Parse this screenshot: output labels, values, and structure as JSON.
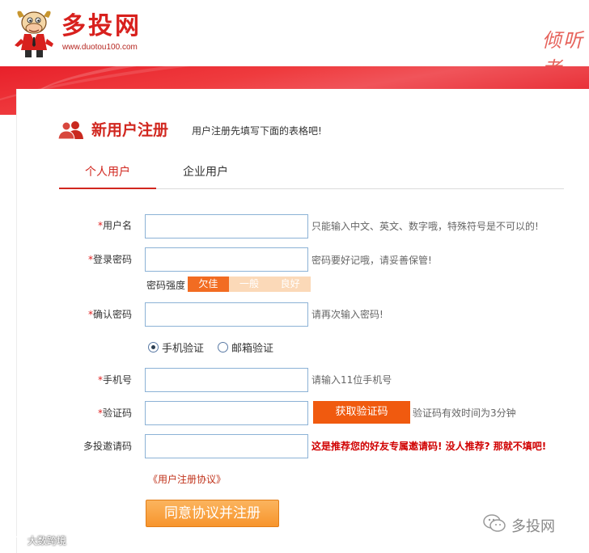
{
  "header": {
    "logo_text": "多投网",
    "logo_url": "www.duotou100.com",
    "slogan": "倾听者"
  },
  "registration": {
    "title": "新用户注册",
    "subtitle": "用户注册先填写下面的表格吧!",
    "tabs": [
      {
        "label": "个人用户",
        "active": true
      },
      {
        "label": "企业用户",
        "active": false
      }
    ],
    "fields": {
      "username": {
        "required_mark": "*",
        "label": "用户名",
        "value": "",
        "hint": "只能输入中文、英文、数字哦，特殊符号是不可以的!"
      },
      "password": {
        "required_mark": "*",
        "label": "登录密码",
        "value": "",
        "hint": "密码要好记哦，请妥善保管!"
      },
      "confirm_password": {
        "required_mark": "*",
        "label": "确认密码",
        "value": "",
        "hint": "请再次输入密码!"
      },
      "phone": {
        "required_mark": "*",
        "label": "手机号",
        "value": "",
        "hint": "请输入11位手机号"
      },
      "code": {
        "required_mark": "*",
        "label": "验证码",
        "value": "",
        "hint": "验证码有效时间为3分钟"
      },
      "invite": {
        "label": "多投邀请码",
        "value": "",
        "hint": "这是推荐您的好友专属邀请码! 没人推荐? 那就不填吧!"
      }
    },
    "password_strength": {
      "label": "密码强度",
      "levels": [
        "欠佳",
        "一般",
        "良好"
      ],
      "current": "欠佳"
    },
    "verify_method": {
      "options": [
        {
          "label": "手机验证",
          "selected": true
        },
        {
          "label": "邮箱验证",
          "selected": false
        }
      ]
    },
    "sms_button_label": "获取验证码",
    "agreement_link": "《用户注册协议》",
    "submit_label": "同意协议并注册"
  },
  "watermarks": {
    "bottom_right": "多投网",
    "bottom_left": "大数跨境"
  },
  "colors": {
    "brand_red": "#d1271f",
    "banner_red": "#e8202a",
    "orange": "#f05a0f",
    "submit_orange": "#f7952d"
  }
}
